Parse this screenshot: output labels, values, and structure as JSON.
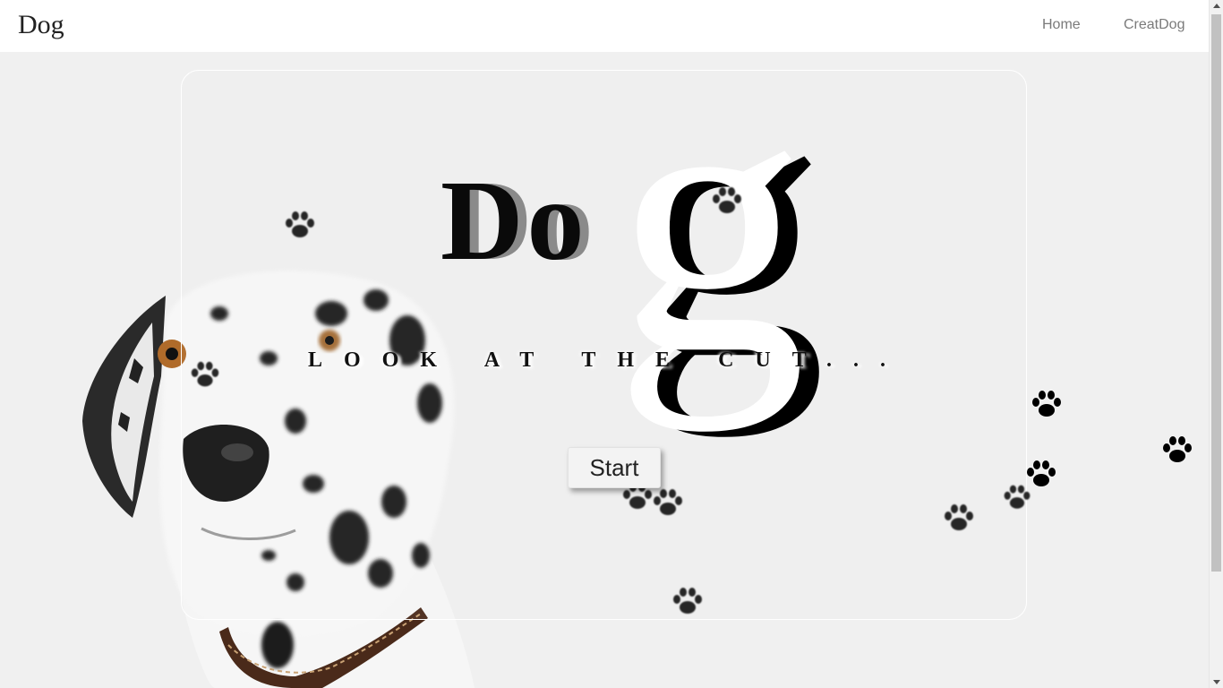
{
  "navbar": {
    "brand": "Dog",
    "links": [
      "Home",
      "CreatDog"
    ]
  },
  "hero": {
    "title_part1": "Do",
    "title_part2": "g",
    "subtitle": "LOOK AT THE CUT...",
    "start_label": "Start"
  },
  "colors": {
    "background": "#f0f0f0",
    "navbar": "#ffffff",
    "title": "#0a0a0a",
    "title_shadow": "#8a8a8a"
  },
  "icons": [
    "paw-print-icon",
    "dalmatian-image"
  ]
}
